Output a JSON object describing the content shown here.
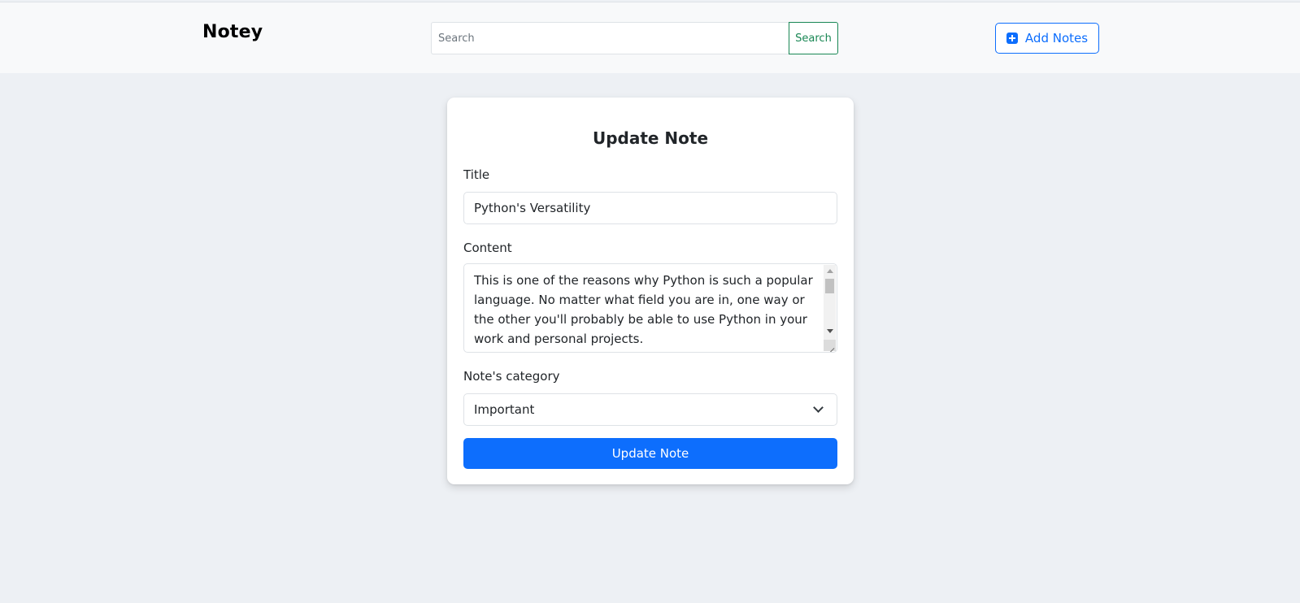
{
  "navbar": {
    "brand": "Notey",
    "search": {
      "placeholder": "Search",
      "value": "",
      "button_label": "Search"
    },
    "add_notes_label": "Add Notes",
    "add_notes_icon": "plus-square-icon"
  },
  "form": {
    "heading": "Update Note",
    "title_label": "Title",
    "title_value": "Python's Versatility",
    "content_label": "Content",
    "content_value": "This is one of the reasons why Python is such a popular language. No matter what field you are in, one way or the other you'll probably be able to use Python in your work and personal projects.",
    "category_label": "Note's category",
    "category_selected": "Important",
    "submit_label": "Update Note"
  },
  "colors": {
    "primary": "#0d6efd",
    "success": "#198754",
    "page_background": "#edf0f4",
    "navbar_background": "#f8f9fa"
  }
}
